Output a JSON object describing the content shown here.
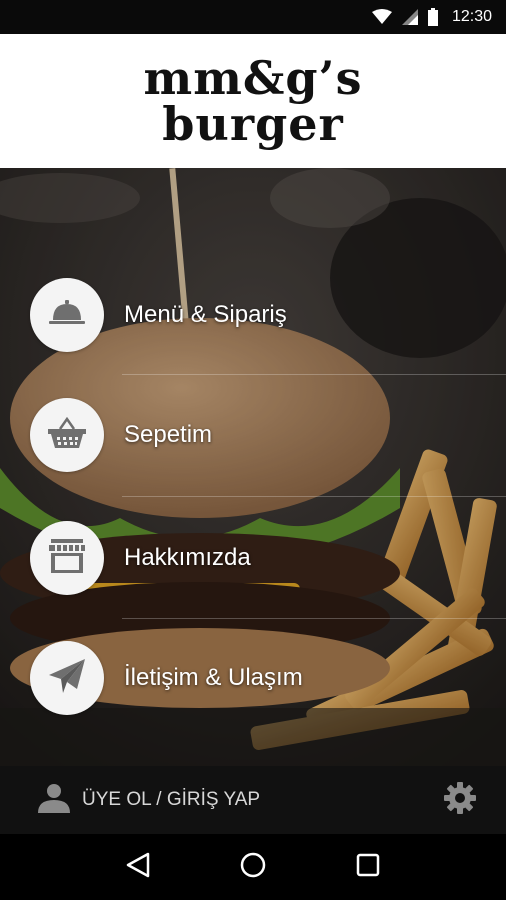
{
  "status_bar": {
    "time": "12:30",
    "icons": [
      "wifi-icon",
      "signal-icon",
      "battery-icon"
    ]
  },
  "header": {
    "logo_line1": "mm&g’s",
    "logo_line2": "burger"
  },
  "menu": {
    "items": [
      {
        "label": "Menü & Sipariş",
        "icon": "cloche-icon"
      },
      {
        "label": "Sepetim",
        "icon": "basket-icon"
      },
      {
        "label": "Hakkımızda",
        "icon": "store-icon"
      },
      {
        "label": "İletişim & Ulaşım",
        "icon": "paper-plane-icon"
      }
    ]
  },
  "bottom_bar": {
    "login_label": "ÜYE OL / GİRİŞ YAP",
    "login_icon": "user-icon",
    "settings_icon": "gear-icon"
  },
  "nav_bar": {
    "icons": [
      "back-icon",
      "home-icon",
      "recents-icon"
    ]
  },
  "colors": {
    "header_bg": "#ffffff",
    "bottom_bar_bg": "#111111",
    "circle_bg": "#f4f4f4",
    "icon_color": "#6f6f6f"
  }
}
